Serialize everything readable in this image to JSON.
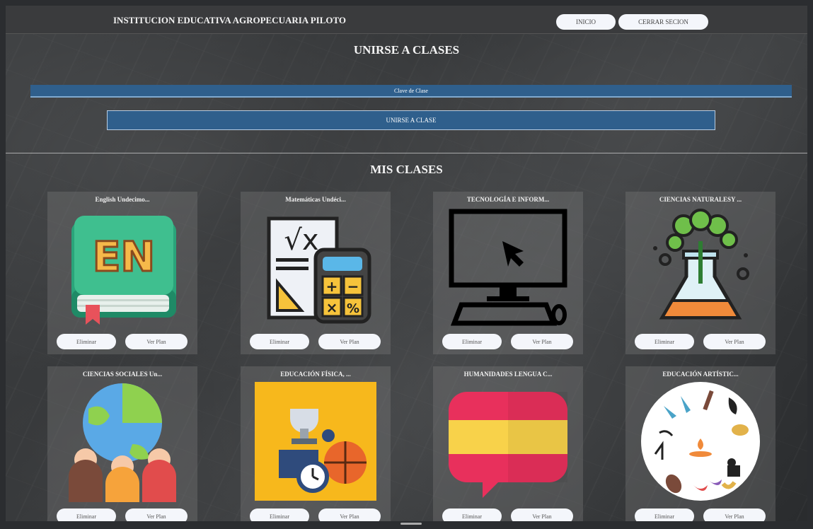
{
  "header": {
    "brand": "INSTITUCION EDUCATIVA AGROPECUARIA PILOTO",
    "inicio_label": "INICIO",
    "cerrar_label": "CERRAR SECION"
  },
  "join": {
    "title": "UNIRSE A CLASES",
    "code_label": "Clave de Clase",
    "button_label": "UNIRSE A CLASE"
  },
  "classes": {
    "title": "MIS CLASES",
    "delete_label": "Eliminar",
    "plan_label": "Ver Plan",
    "items": [
      {
        "name": "English Undecimo...",
        "icon": "english-book-icon"
      },
      {
        "name": "Matemáticas Undéci...",
        "icon": "calculator-icon"
      },
      {
        "name": "TECNOLOGÍA E INFORM...",
        "icon": "computer-icon"
      },
      {
        "name": "CIENCIAS NATURALESY ...",
        "icon": "flask-plant-icon"
      },
      {
        "name": "CIENCIAS SOCIALES Un...",
        "icon": "globe-people-icon"
      },
      {
        "name": "EDUCACIÓN FÍSICA, ...",
        "icon": "sports-icon"
      },
      {
        "name": "HUMANIDADES LENGUA C...",
        "icon": "spain-flag-icon"
      },
      {
        "name": "EDUCACIÓN ARTÍSTIC...",
        "icon": "arts-icon"
      }
    ]
  },
  "colors": {
    "accent_blue": "#2f5f8c",
    "button_bg": "#f4f6fb",
    "topbar": "#3a3b3d"
  }
}
